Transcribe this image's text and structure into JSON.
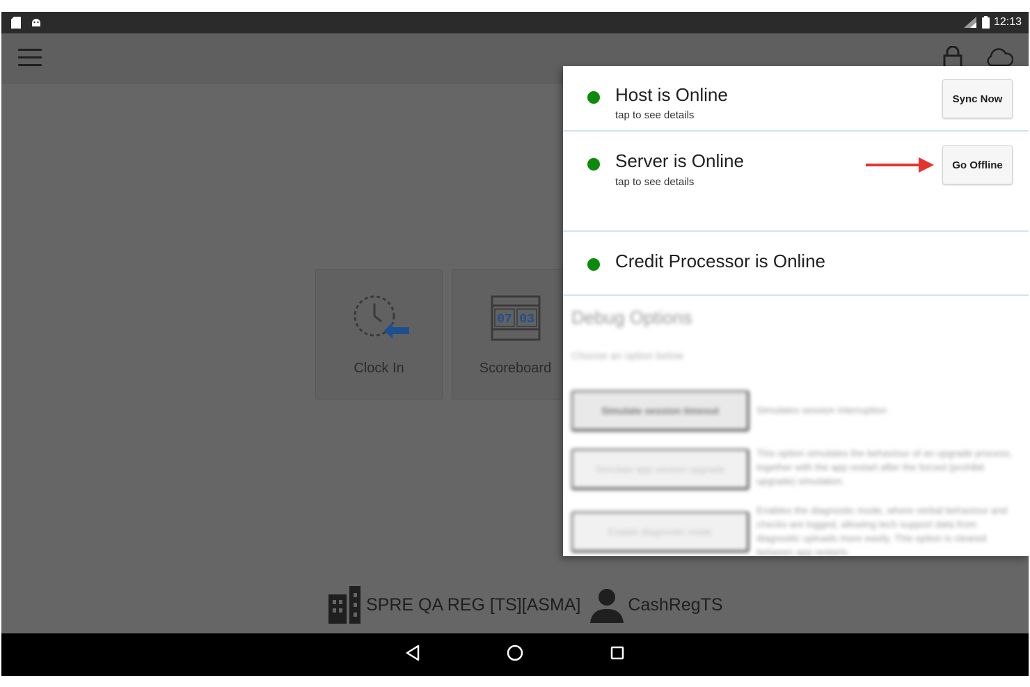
{
  "status_bar": {
    "time": "12:13"
  },
  "tiles": [
    {
      "label": "Clock In",
      "icon": "clock-in-icon"
    },
    {
      "label": "Scoreboard",
      "icon": "scoreboard-icon",
      "digits_left": "07",
      "digits_right": "03"
    }
  ],
  "footer": {
    "location": "SPRE QA REG [TS][ASMA]",
    "user": "CashRegTS"
  },
  "status_panel": {
    "host": {
      "title": "Host is Online",
      "subtitle": "tap to see details",
      "button": "Sync Now"
    },
    "server": {
      "title": "Server is Online",
      "subtitle": "tap to see details",
      "button": "Go Offline"
    },
    "credit": {
      "title": "Credit Processor is Online"
    },
    "debug": {
      "heading": "Debug Options",
      "subheading": "Choose an option below",
      "buttons": [
        {
          "label": "Simulate session timeout",
          "desc": "Simulates session interruption"
        },
        {
          "label": "Simulate app version upgrade",
          "desc": "This option simulates the behaviour of an upgrade process, together with the app restart after the forced (prohibit upgrade) simulation."
        },
        {
          "label": "Enable diagnostic mode",
          "desc": "Enables the diagnostic mode, where verbal behaviour and checks are logged, allowing tech support data from diagnostic uploads more easily. This option is cleared between app restarts."
        }
      ]
    }
  },
  "colors": {
    "online_dot": "#0c8a0c",
    "annotation_arrow": "#e8322e",
    "scoreboard_digits": "#1e4f8f",
    "clock_arrow": "#1e4f8f"
  }
}
